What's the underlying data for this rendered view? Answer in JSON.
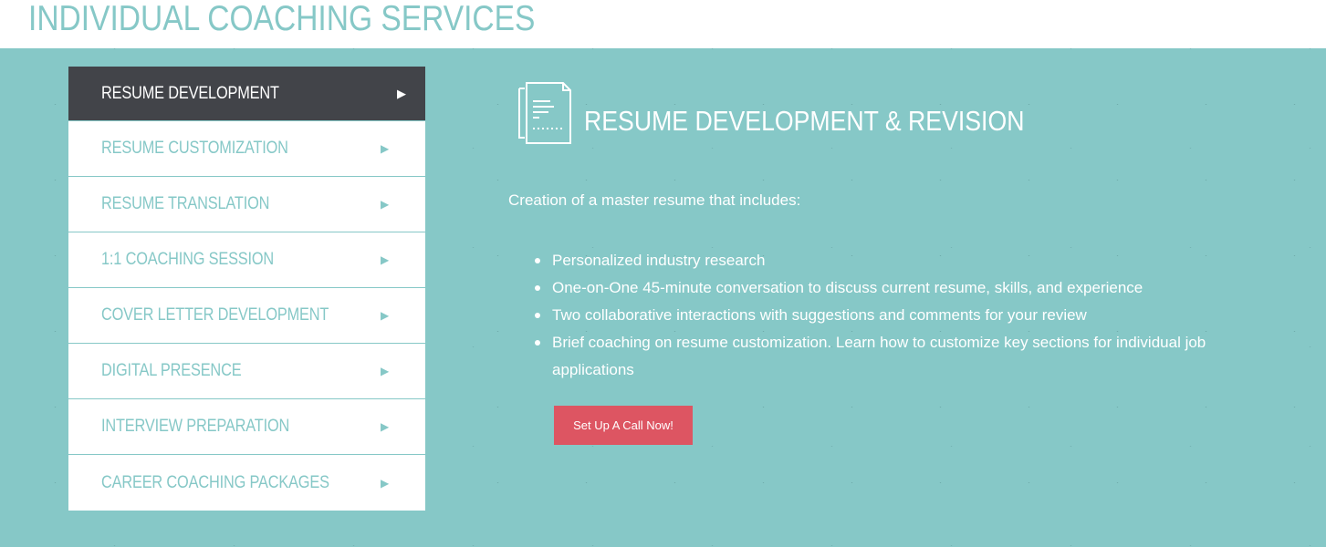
{
  "header": {
    "title": "INDIVIDUAL COACHING SERVICES"
  },
  "menu": {
    "items": [
      {
        "label": "RESUME DEVELOPMENT",
        "active": true
      },
      {
        "label": "RESUME CUSTOMIZATION",
        "active": false
      },
      {
        "label": "RESUME TRANSLATION",
        "active": false
      },
      {
        "label": "1:1 COACHING SESSION",
        "active": false
      },
      {
        "label": "COVER LETTER DEVELOPMENT",
        "active": false
      },
      {
        "label": "DIGITAL PRESENCE",
        "active": false
      },
      {
        "label": "INTERVIEW PREPARATION",
        "active": false
      },
      {
        "label": "CAREER COACHING PACKAGES",
        "active": false
      }
    ],
    "arrow_glyph": "▶"
  },
  "content": {
    "icon": "document-icon",
    "title": "RESUME DEVELOPMENT & REVISION",
    "intro": "Creation of a master resume that includes:",
    "bullets": [
      "Personalized industry research",
      "One-on-One 45-minute conversation to discuss current resume, skills, and experience",
      "Two collaborative interactions with suggestions and comments for your review",
      "Brief coaching on resume customization. Learn how to customize key sections for individual job applications"
    ],
    "cta_label": "Set Up A Call Now!"
  },
  "colors": {
    "teal": "#86c8c7",
    "dark": "#424449",
    "cta": "#dd5562",
    "white": "#ffffff"
  }
}
